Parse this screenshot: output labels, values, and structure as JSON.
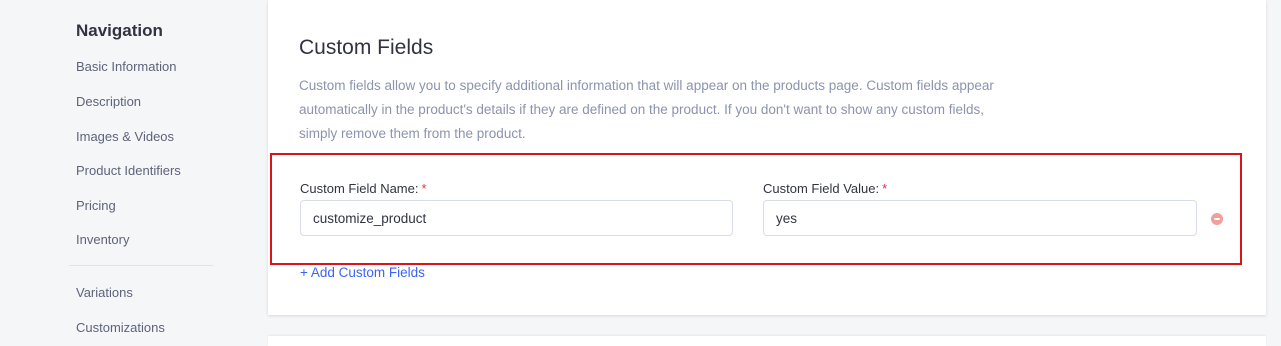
{
  "sidebar": {
    "heading": "Navigation",
    "items": [
      {
        "label": "Basic Information"
      },
      {
        "label": "Description"
      },
      {
        "label": "Images & Videos"
      },
      {
        "label": "Product Identifiers"
      },
      {
        "label": "Pricing"
      },
      {
        "label": "Inventory"
      }
    ],
    "items2": [
      {
        "label": "Variations"
      },
      {
        "label": "Customizations"
      }
    ]
  },
  "custom_fields": {
    "title": "Custom Fields",
    "description": "Custom fields allow you to specify additional information that will appear on the products page. Custom fields appear automatically in the product's details if they are defined on the product. If you don't want to show any custom fields, simply remove them from the product.",
    "name_label": "Custom Field Name:",
    "value_label": "Custom Field Value:",
    "required_mark": "*",
    "name_value": "customize_product",
    "value_value": "yes",
    "add_link": "+ Add Custom Fields",
    "remove_icon": "remove-circle-icon",
    "highlight_color": "#d9141b",
    "link_color": "#3c64f4"
  }
}
